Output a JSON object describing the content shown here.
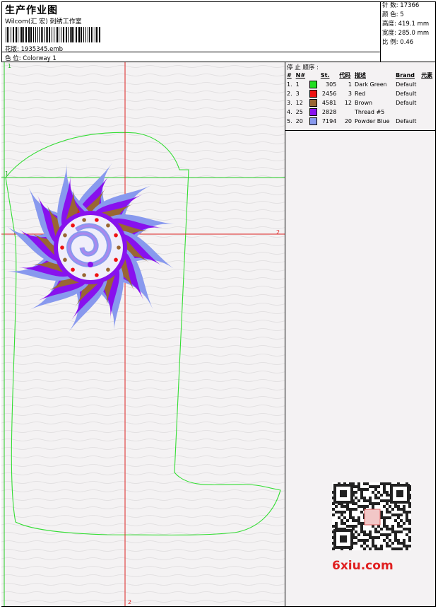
{
  "header": {
    "title": "生产作业图",
    "company": "Wilcom(汇 宏) 刺绣工作室",
    "file_label": "花版:",
    "file_name": "1935345.emb",
    "colorway_label": "色 位:",
    "colorway": "Colorway 1"
  },
  "stats": {
    "stitches_label": "针 数:",
    "stitches": "17366",
    "colors_label": "颜 色:",
    "colors": "5",
    "height_label": "高度:",
    "height": "419.1 mm",
    "width_label": "宽度:",
    "width": "285.0 mm",
    "scale_label": "比 例:",
    "scale": "0.46"
  },
  "stop_sequence": {
    "title": "停 止 顺序 :",
    "columns": [
      "#",
      "N#",
      "St.",
      "代码",
      "描述",
      "Brand",
      "元素"
    ],
    "rows": [
      {
        "idx": "1.",
        "n": "1",
        "color": "#22dd22",
        "st": "305",
        "code": "1",
        "desc": "Dark Green",
        "brand": "Default"
      },
      {
        "idx": "2.",
        "n": "3",
        "color": "#ee1111",
        "st": "2456",
        "code": "3",
        "desc": "Red",
        "brand": "Default"
      },
      {
        "idx": "3.",
        "n": "12",
        "color": "#996633",
        "st": "4581",
        "code": "12",
        "desc": "Brown",
        "brand": "Default"
      },
      {
        "idx": "4.",
        "n": "25",
        "color": "#8811ee",
        "st": "2828",
        "code": "",
        "desc": "Thread #5",
        "brand": ""
      },
      {
        "idx": "5.",
        "n": "20",
        "color": "#8899ee",
        "st": "7194",
        "code": "20",
        "desc": "Powder Blue",
        "brand": "Default"
      }
    ]
  },
  "markers": {
    "top_left": "1",
    "hline_left": "1",
    "hline_right": "2",
    "bottom": "2"
  },
  "watermark": "6xiu.com"
}
